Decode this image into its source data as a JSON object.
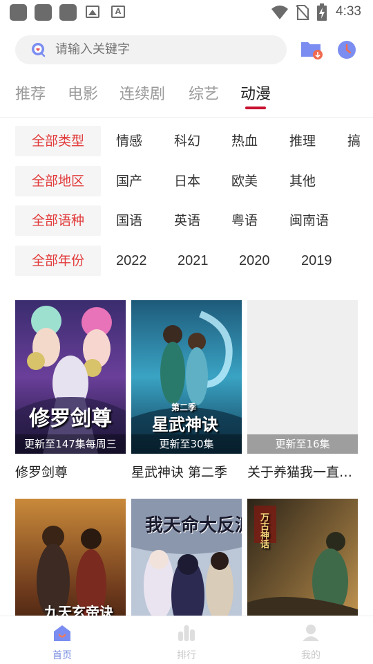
{
  "status_bar": {
    "time": "4:33",
    "notif_letter": "A"
  },
  "search": {
    "placeholder": "请输入关键字"
  },
  "tabs": [
    {
      "label": "推荐",
      "active": false
    },
    {
      "label": "电影",
      "active": false
    },
    {
      "label": "连续剧",
      "active": false
    },
    {
      "label": "综艺",
      "active": false
    },
    {
      "label": "动漫",
      "active": true
    }
  ],
  "filters": {
    "type": {
      "all": "全部类型",
      "options": [
        "情感",
        "科幻",
        "热血",
        "推理",
        "搞"
      ]
    },
    "region": {
      "all": "全部地区",
      "options": [
        "国产",
        "日本",
        "欧美",
        "其他"
      ]
    },
    "language": {
      "all": "全部语种",
      "options": [
        "国语",
        "英语",
        "粤语",
        "闽南语"
      ]
    },
    "year": {
      "all": "全部年份",
      "options": [
        "2022",
        "2021",
        "2020",
        "2019"
      ]
    }
  },
  "cards": [
    {
      "title": "修罗剑尊",
      "update": "更新至147集每周三",
      "poster_text": "修罗剑尊"
    },
    {
      "title": "星武神诀 第二季",
      "update": "更新至30集",
      "poster_text": "星武神诀",
      "poster_sub": "第二季"
    },
    {
      "title": "关于养猫我一直是新手",
      "update": "更新至16集"
    },
    {
      "title": "",
      "update": "",
      "poster_text": "九天玄帝诀"
    },
    {
      "title": "",
      "update": "",
      "poster_text": "我天命大反派"
    },
    {
      "title": "",
      "update": "",
      "poster_text": "万古神话"
    }
  ],
  "bottom_nav": [
    {
      "label": "首页",
      "active": true
    },
    {
      "label": "排行",
      "active": false
    },
    {
      "label": "我的",
      "active": false
    }
  ],
  "colors": {
    "accent": "#e23a3a",
    "tab_indicator": "#c8102e",
    "nav_active": "#7a8ee0",
    "icon_blue": "#6f8ef0"
  }
}
